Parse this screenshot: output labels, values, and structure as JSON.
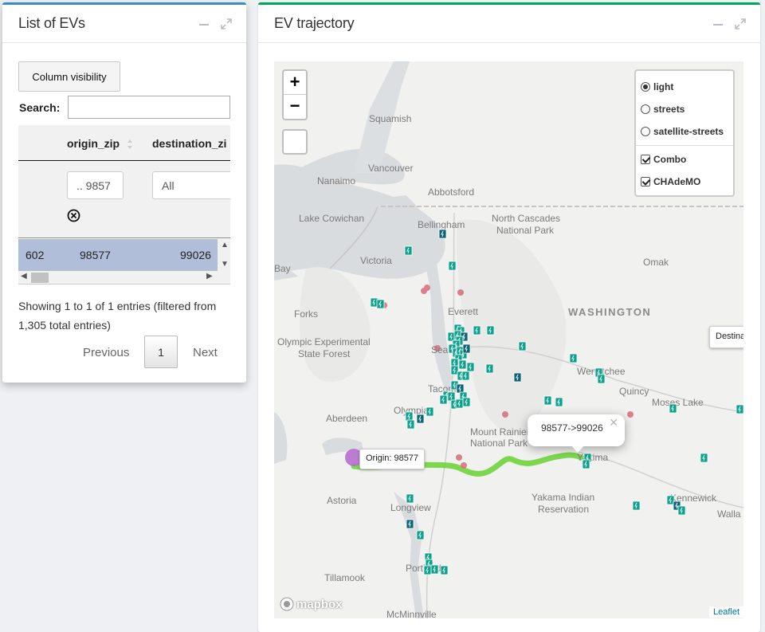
{
  "left_panel": {
    "title": "List of EVs",
    "column_visibility_label": "Column visibility",
    "search_label": "Search:",
    "search_value": "",
    "columns": [
      "origin_zip",
      "destination_zi"
    ],
    "filters": {
      "origin_zip": ".. 9857",
      "destination_zip": "All"
    },
    "rows": [
      {
        "id": "602",
        "origin_zip": "98577",
        "destination_zip": "99026"
      }
    ],
    "info": "Showing 1 to 1 of 1 entries (filtered from 1,305 total entries)",
    "pagination": {
      "previous": "Previous",
      "current": "1",
      "next": "Next"
    }
  },
  "right_panel": {
    "title": "EV trajectory",
    "zoom_in": "+",
    "zoom_out": "−",
    "base_layers": [
      {
        "label": "light",
        "selected": true
      },
      {
        "label": "streets",
        "selected": false
      },
      {
        "label": "satellite-streets",
        "selected": false
      }
    ],
    "overlays": [
      {
        "label": "Combo",
        "checked": true
      },
      {
        "label": "CHAdeMO",
        "checked": true
      }
    ],
    "popup_text": "98577->99026",
    "origin_label": "Origin: 98577",
    "destination_label": "Destina",
    "attribution_logo": "mapbox",
    "attribution_link": "Leaflet",
    "place_labels": [
      "Squamish",
      "Vancouver",
      "Abbotsford",
      "Nanaimo",
      "Lake Cowichan",
      "Bellingham",
      "North Cascades",
      "National Park",
      "Victoria",
      "Omak",
      "WASHINGTON",
      "Forks",
      "Olympic Experimental",
      "State Forest",
      "Everett",
      "Seattle",
      "Wenatchee",
      "Quincy",
      "Moses Lake",
      "Tacoma",
      "Olympia",
      "Aberdeen",
      "Mount Rainier",
      "National Park",
      "Yakima",
      "Yakama Indian",
      "Reservation",
      "Kennewick",
      "Walla",
      "Astoria",
      "Longview",
      "Tillamook",
      "Portland",
      "McMinnville",
      "Bay"
    ],
    "colors": {
      "route": "#6fd43d",
      "charger": "#0aa28c",
      "charger_dark": "#0c6478",
      "point": "#d96c7c",
      "origin": "#b66fd0"
    }
  }
}
